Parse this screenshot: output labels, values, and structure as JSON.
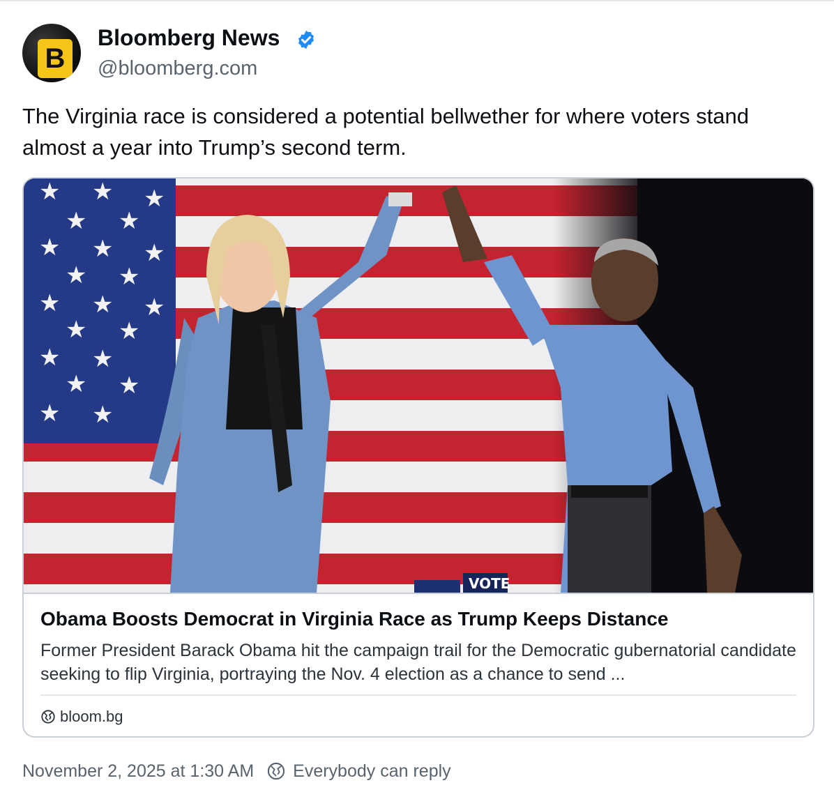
{
  "account": {
    "display_name": "Bloomberg News",
    "handle": "@bloomberg.com",
    "avatar_letter": "B",
    "verified": true,
    "verified_color": "#1d8cf8",
    "avatar_accent": "#f5c518"
  },
  "post": {
    "text": "The Virginia race is considered a potential bellwether for where voters stand almost a year into Trump’s second term."
  },
  "link_card": {
    "image_icon": "photo-rally-flag",
    "image_sign_text": "VOTE",
    "title": "Obama Boosts Democrat in Virginia Race as Trump Keeps Distance",
    "description": "Former President Barack Obama hit the campaign trail for the Democratic gubernatorial candidate seeking to flip Virginia, portraying the Nov. 4 election as a chance to send ...",
    "source_icon": "globe-icon",
    "source": "bloom.bg"
  },
  "footer": {
    "timestamp": "November 2, 2025 at 1:30 AM",
    "reply_icon": "globe-icon",
    "reply_setting": "Everybody can reply"
  }
}
